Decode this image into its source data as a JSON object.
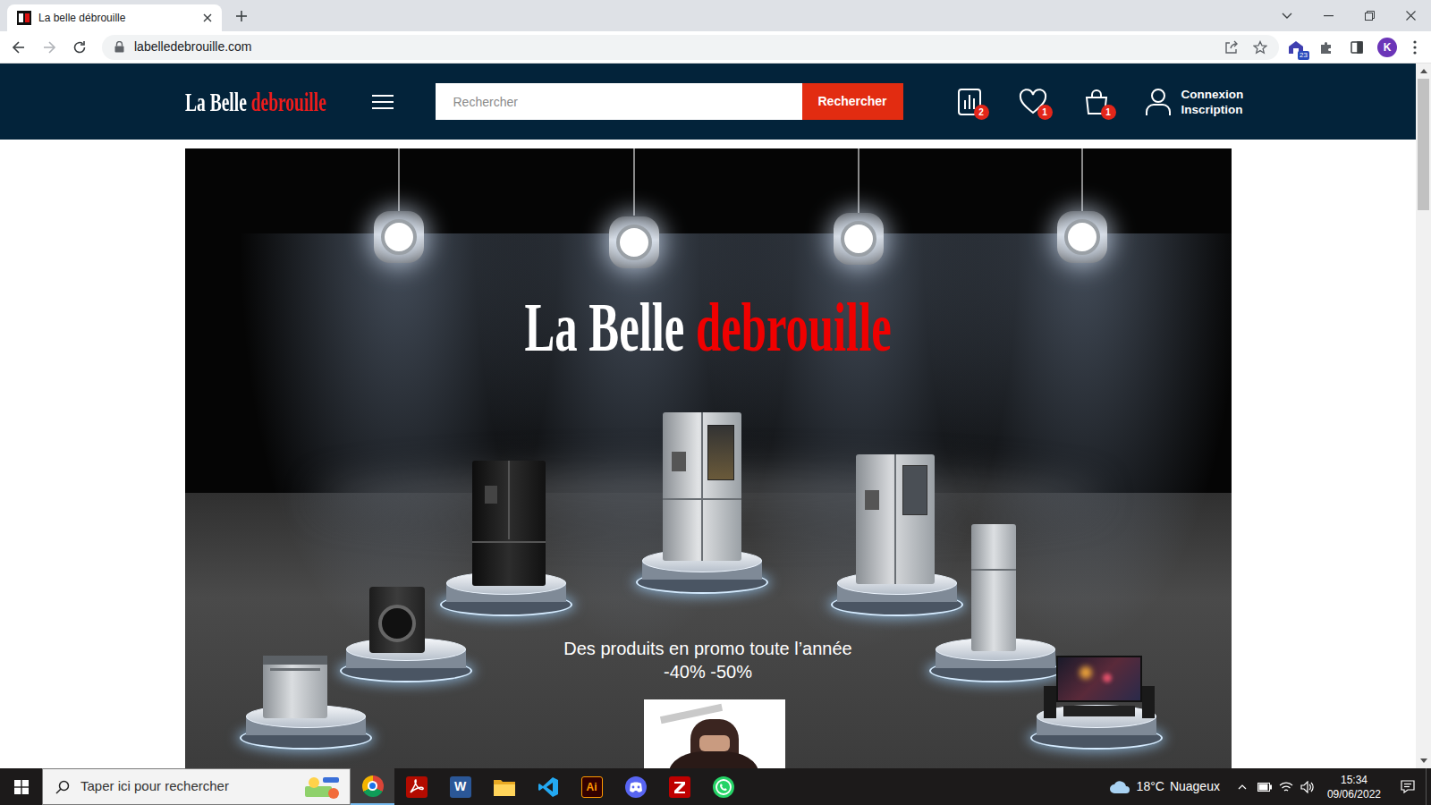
{
  "browser": {
    "tab_title": "La belle débrouille",
    "url": "labelledebrouille.com",
    "extension_badge": "23",
    "profile": "K"
  },
  "site": {
    "logo": {
      "first": "La Belle",
      "second": "debrouille"
    },
    "search": {
      "placeholder": "Rechercher",
      "button": "Rechercher"
    },
    "header_icons": [
      {
        "kind": "compare",
        "badge": "2"
      },
      {
        "kind": "wishlist",
        "badge": "1"
      },
      {
        "kind": "cart",
        "badge": "1"
      }
    ],
    "account": {
      "login": "Connexion",
      "register": "Inscription"
    }
  },
  "hero": {
    "title": {
      "first": "La Belle",
      "second": "debrouille"
    },
    "tagline": "Des produits en promo toute l’année",
    "discount": "-40% -50%"
  },
  "taskbar": {
    "search_placeholder": "Taper ici pour rechercher",
    "apps": [
      {
        "kind": "chrome",
        "selected": true
      },
      {
        "kind": "acrobat",
        "selected": false
      },
      {
        "kind": "word",
        "glyph": "W",
        "selected": false
      },
      {
        "kind": "explorer",
        "selected": false
      },
      {
        "kind": "vscode",
        "selected": false
      },
      {
        "kind": "illustrator",
        "glyph": "Ai",
        "selected": false
      },
      {
        "kind": "discord",
        "selected": false
      },
      {
        "kind": "filezilla",
        "selected": false
      },
      {
        "kind": "whatsapp",
        "selected": false
      }
    ],
    "weather": {
      "temperature": "18°C",
      "condition": "Nuageux"
    },
    "clock": {
      "time": "15:34",
      "date": "09/06/2022"
    }
  }
}
